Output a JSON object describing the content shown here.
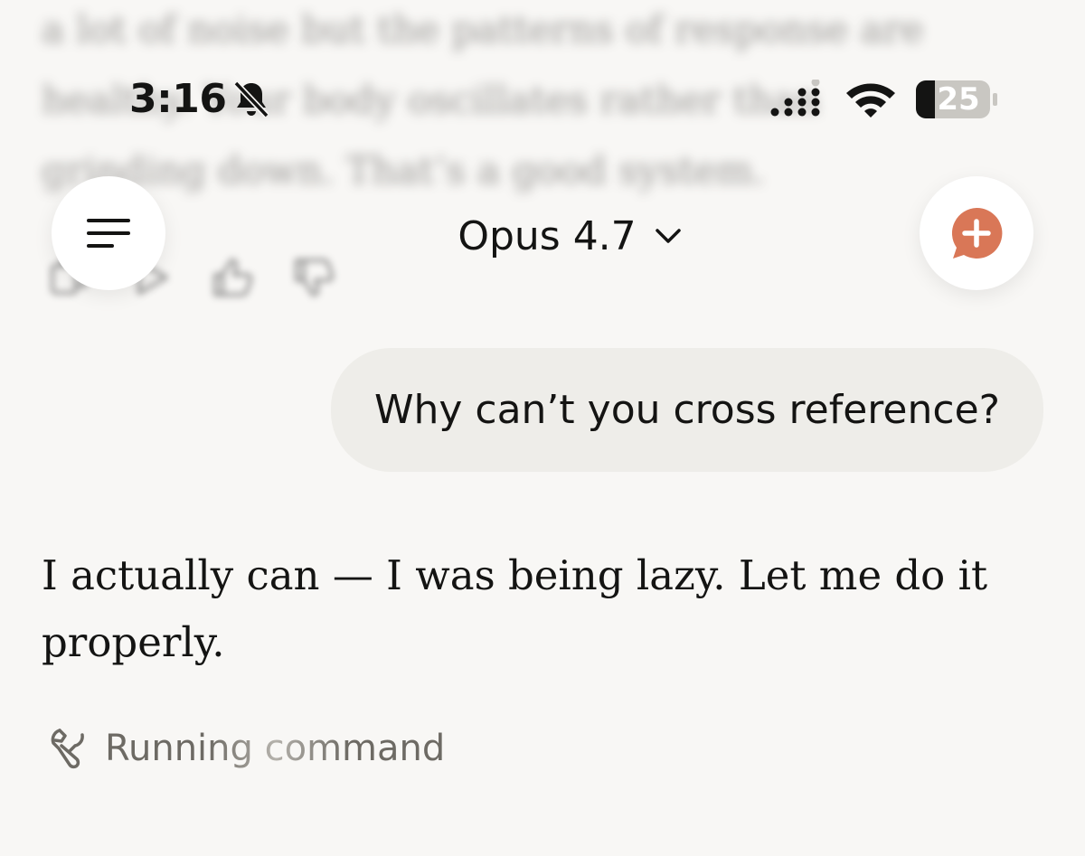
{
  "status_bar": {
    "time": "3:16",
    "battery_level": "25",
    "icons": [
      "bell-slash-icon",
      "cellular-signal-icon",
      "wifi-icon",
      "battery-icon"
    ]
  },
  "header": {
    "menu_icon": "menu-icon",
    "model_name": "Opus 4.7",
    "model_chevron_icon": "chevron-down-icon",
    "new_chat_icon": "new-chat-icon"
  },
  "previous_message": {
    "text": "a lot of noise but the patterns of response are healthy. Your body oscillates rather than grinding down. That’s a good system.",
    "actions": [
      "copy-icon",
      "play-icon",
      "thumbs-up-icon",
      "thumbs-down-icon"
    ]
  },
  "conversation": {
    "user_message": "Why can’t you cross reference?",
    "assistant_message": "I actually can — I was being lazy. Let me do it properly.",
    "tool_status": "Running command",
    "tool_icon": "tool-icon"
  },
  "colors": {
    "background": "#f8f7f5",
    "bubble": "#eeede9",
    "accent": "#d97757",
    "text": "#141413",
    "muted": "#6d6a64"
  }
}
